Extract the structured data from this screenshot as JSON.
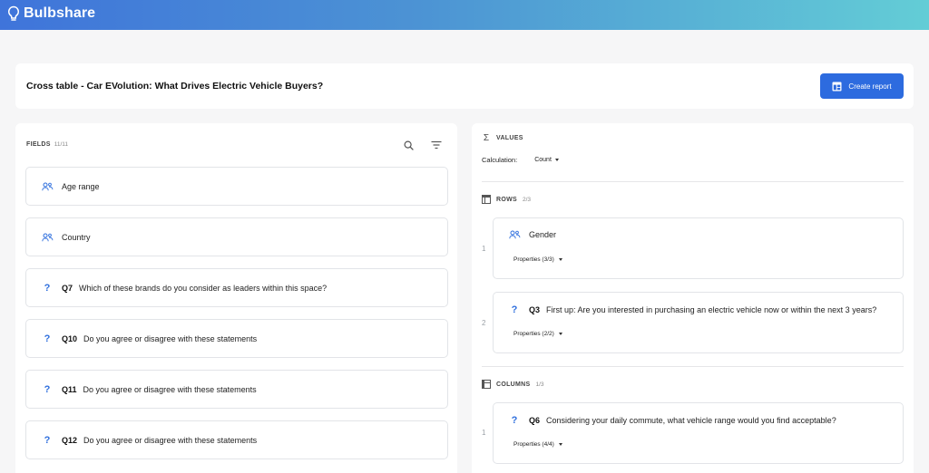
{
  "app": {
    "brand": "Bulbshare"
  },
  "header": {
    "title": "Cross table - Car EVolution: What Drives Electric Vehicle Buyers?",
    "create_report_label": "Create report"
  },
  "fields": {
    "label": "FIELDS",
    "count": "11/11",
    "items": [
      {
        "type": "demographic",
        "icon": "people-icon",
        "code": "",
        "text": "Age range"
      },
      {
        "type": "demographic",
        "icon": "people-icon",
        "code": "",
        "text": "Country"
      },
      {
        "type": "question",
        "icon": "question-icon",
        "code": "Q7",
        "text": "Which of these brands do you consider as leaders within this space?"
      },
      {
        "type": "question",
        "icon": "question-icon",
        "code": "Q10",
        "text": "Do you agree or disagree with these statements"
      },
      {
        "type": "question",
        "icon": "question-icon",
        "code": "Q11",
        "text": "Do you agree or disagree with these statements"
      },
      {
        "type": "question",
        "icon": "question-icon",
        "code": "Q12",
        "text": "Do you agree or disagree with these statements"
      }
    ]
  },
  "values": {
    "label": "VALUES",
    "calculation_label": "Calculation:",
    "calculation_value": "Count"
  },
  "rows": {
    "label": "ROWS",
    "count": "2/3",
    "items": [
      {
        "index": "1",
        "icon": "people-icon",
        "code": "",
        "text": "Gender",
        "properties": "Properties (3/3)"
      },
      {
        "index": "2",
        "icon": "question-icon",
        "code": "Q3",
        "text": "First up: Are you interested in purchasing an electric vehicle now or within the next 3 years?",
        "properties": "Properties (2/2)"
      }
    ]
  },
  "columns": {
    "label": "COLUMNS",
    "count": "1/3",
    "items": [
      {
        "index": "1",
        "icon": "question-icon",
        "code": "Q6",
        "text": "Considering your daily commute, what vehicle range would you find acceptable?",
        "properties": "Properties (4/4)"
      }
    ]
  },
  "colors": {
    "accent": "#2d6bdf",
    "gradient_start": "#3f74da",
    "gradient_end": "#63cdd6"
  }
}
